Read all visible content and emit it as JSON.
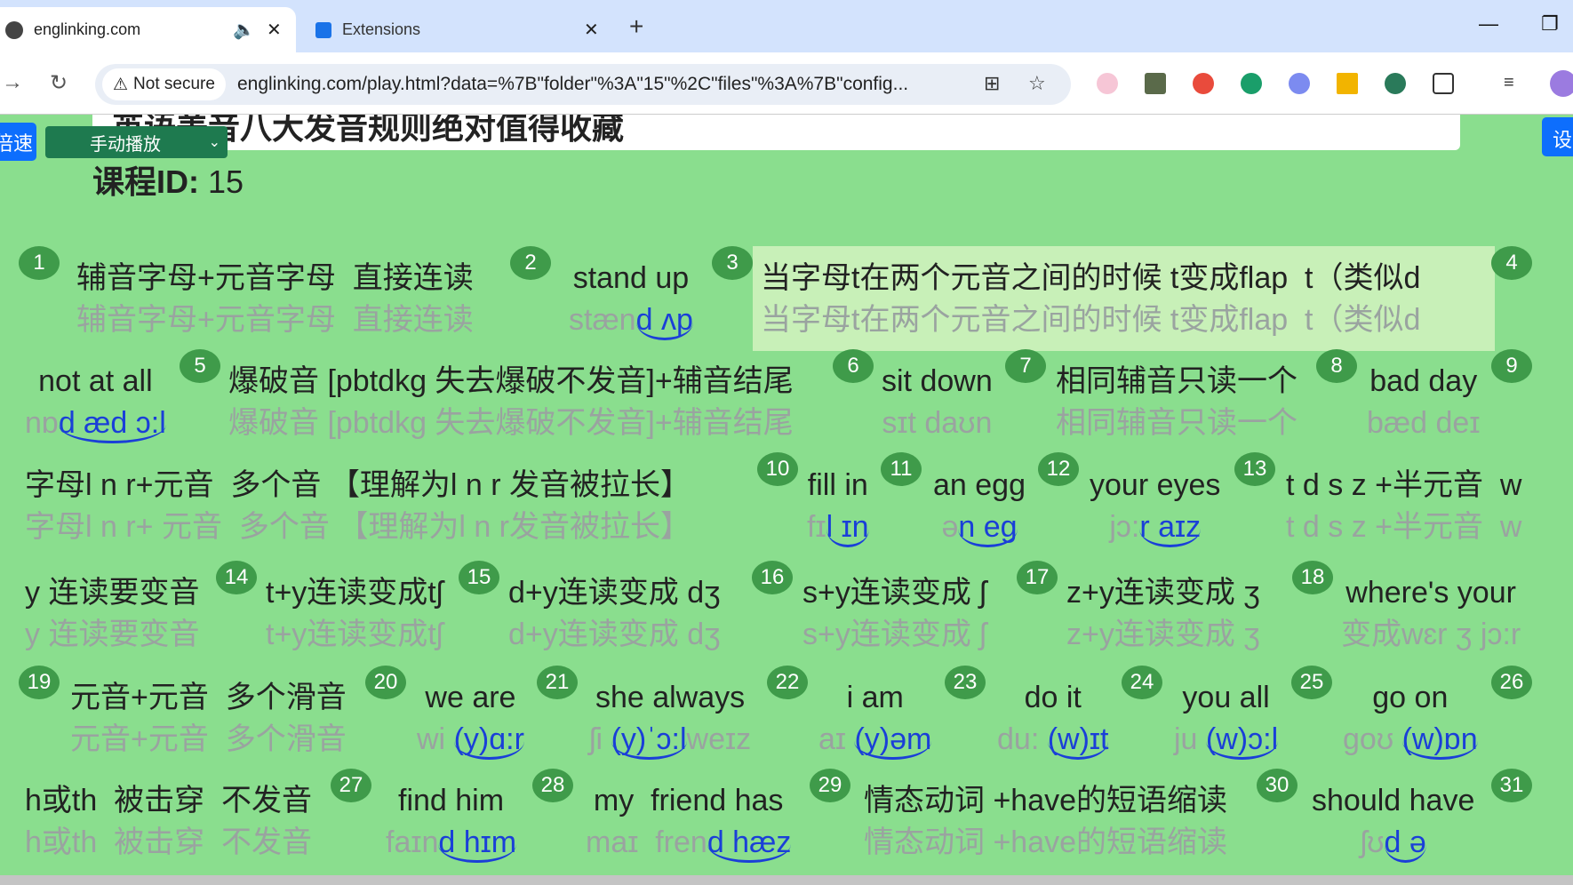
{
  "browser": {
    "tabs": [
      {
        "title": "englinking.com",
        "active": true
      },
      {
        "title": "Extensions",
        "active": false
      }
    ],
    "not_secure_label": "Not secure",
    "url": "englinking.com/play.html?data=%7B\"folder\"%3A\"15\"%2C\"files\"%3A%7B\"config...",
    "icons": [
      "back-icon",
      "reload-icon",
      "translate-icon",
      "star-icon",
      "extensions-icon",
      "media-icon",
      "profile-avatar"
    ]
  },
  "page": {
    "title": "英语美音八大发音规则绝对值得收藏",
    "speed_button": "倍速",
    "play_mode": "手动播放",
    "settings_button": "设",
    "course_id_label": "课程ID:",
    "course_id": "15",
    "colors": {
      "background": "#8ade8e",
      "badge": "#3f9b4a",
      "link": "#1a3fd8",
      "highlight": "#c8f0b8"
    },
    "items": [
      {
        "num": "1",
        "segments": [
          {
            "text": "辅音字母+元音字母  直接连读",
            "phon": "辅音字母+元音字母  直接连读",
            "link": ""
          }
        ]
      },
      {
        "num": "2",
        "segments": [
          {
            "text": "stand up",
            "phon": "stæn",
            "link": "d ʌp"
          }
        ]
      },
      {
        "num": "3",
        "active": true,
        "segments": [
          {
            "text": "当字母t在两个元音之间的时候 t变成flap  t（类似d",
            "phon": "当字母t在两个元音之间的时候 t变成flap  t（类似d",
            "link": ""
          }
        ]
      },
      {
        "num": "4",
        "segments": [
          {
            "text": "not at all",
            "phon": "nɒ",
            "link": "d æd ɔ:l"
          }
        ]
      },
      {
        "num": "5",
        "segments": [
          {
            "text": "爆破音 [pbtdkg 失去爆破不发音]+辅音结尾",
            "phon": "爆破音 [pbtdkg 失去爆破不发音]+辅音结尾",
            "link": ""
          }
        ]
      },
      {
        "num": "6",
        "segments": [
          {
            "text": "sit down",
            "phon": "sɪt daʊn",
            "link": ""
          }
        ]
      },
      {
        "num": "7",
        "segments": [
          {
            "text": "相同辅音只读一个",
            "phon": "相同辅音只读一个",
            "link": ""
          }
        ]
      },
      {
        "num": "8",
        "segments": [
          {
            "text": "bad day",
            "phon": "bæd deɪ",
            "link": ""
          }
        ]
      },
      {
        "num": "9",
        "segments": [
          {
            "text": "字母l n r+元音  多个音 【理解为l n r 发音被拉长】",
            "phon": "字母l n r+ 元音  多个音 【理解为l n r发音被拉长】",
            "link": ""
          }
        ]
      },
      {
        "num": "10",
        "segments": [
          {
            "text": "fill in",
            "phon": "fɪ",
            "link": "l ɪn"
          }
        ]
      },
      {
        "num": "11",
        "segments": [
          {
            "text": "an egg",
            "phon": "ə",
            "link": "n eg"
          }
        ]
      },
      {
        "num": "12",
        "segments": [
          {
            "text": "your eyes",
            "phon": "jɔ:",
            "link": "r aɪz"
          }
        ]
      },
      {
        "num": "13",
        "segments": [
          {
            "text": "t d s z +半元音  w",
            "phon": "t d s z +半元音  w",
            "link": ""
          },
          {
            "text": "y 连读要变音",
            "phon": "y 连读要变音",
            "link": ""
          }
        ]
      },
      {
        "num": "14",
        "segments": [
          {
            "text": "t+y连读变成tʃ",
            "phon": "t+y连读变成tʃ",
            "link": ""
          }
        ]
      },
      {
        "num": "15",
        "segments": [
          {
            "text": "d+y连读变成 dʒ",
            "phon": "d+y连读变成 dʒ",
            "link": ""
          }
        ]
      },
      {
        "num": "16",
        "segments": [
          {
            "text": "s+y连读变成 ʃ",
            "phon": "s+y连读变成 ʃ",
            "link": ""
          }
        ]
      },
      {
        "num": "17",
        "segments": [
          {
            "text": "z+y连读变成 ʒ",
            "phon": "z+y连读变成 ʒ",
            "link": ""
          }
        ]
      },
      {
        "num": "18",
        "segments": [
          {
            "text": "where's your",
            "phon": "变成wɛr ʒ jɔ:r",
            "link": ""
          }
        ]
      },
      {
        "num": "19",
        "segments": [
          {
            "text": "元音+元音  多个滑音",
            "phon": "元音+元音  多个滑音",
            "link": ""
          }
        ]
      },
      {
        "num": "20",
        "segments": [
          {
            "text": "we are",
            "phon": "wi ",
            "link": "(y)ɑ:r"
          }
        ]
      },
      {
        "num": "21",
        "segments": [
          {
            "text": "she always",
            "phon": "ʃi ",
            "link": "(y)ˈɔ:l",
            "phon_after": "weɪz"
          }
        ]
      },
      {
        "num": "22",
        "segments": [
          {
            "text": "i am",
            "phon": "aɪ ",
            "link": "(y)əm"
          }
        ]
      },
      {
        "num": "23",
        "segments": [
          {
            "text": "do it",
            "phon": "du: ",
            "link": "(w)ɪt"
          }
        ]
      },
      {
        "num": "24",
        "segments": [
          {
            "text": "you all",
            "phon": "ju ",
            "link": "(w)ɔ:l"
          }
        ]
      },
      {
        "num": "25",
        "segments": [
          {
            "text": "go on",
            "phon": "goʊ ",
            "link": "(w)ɒn"
          }
        ]
      },
      {
        "num": "26",
        "segments": [
          {
            "text": "h或th  被击穿  不发音",
            "phon": "h或th  被击穿  不发音",
            "link": ""
          }
        ]
      },
      {
        "num": "27",
        "segments": [
          {
            "text": "find him",
            "phon": "faɪn",
            "link": "d hɪm"
          }
        ]
      },
      {
        "num": "28",
        "segments": [
          {
            "text": "my  friend has",
            "phon": "maɪ  fren",
            "link": "d hæz"
          }
        ]
      },
      {
        "num": "29",
        "segments": [
          {
            "text": "情态动词 +have的短语缩读",
            "phon": "情态动词 +have的短语缩读",
            "link": ""
          }
        ]
      },
      {
        "num": "30",
        "segments": [
          {
            "text": "should have",
            "phon": "ʃʊ",
            "link": "d ə"
          }
        ]
      },
      {
        "num": "31",
        "segments": []
      }
    ]
  }
}
